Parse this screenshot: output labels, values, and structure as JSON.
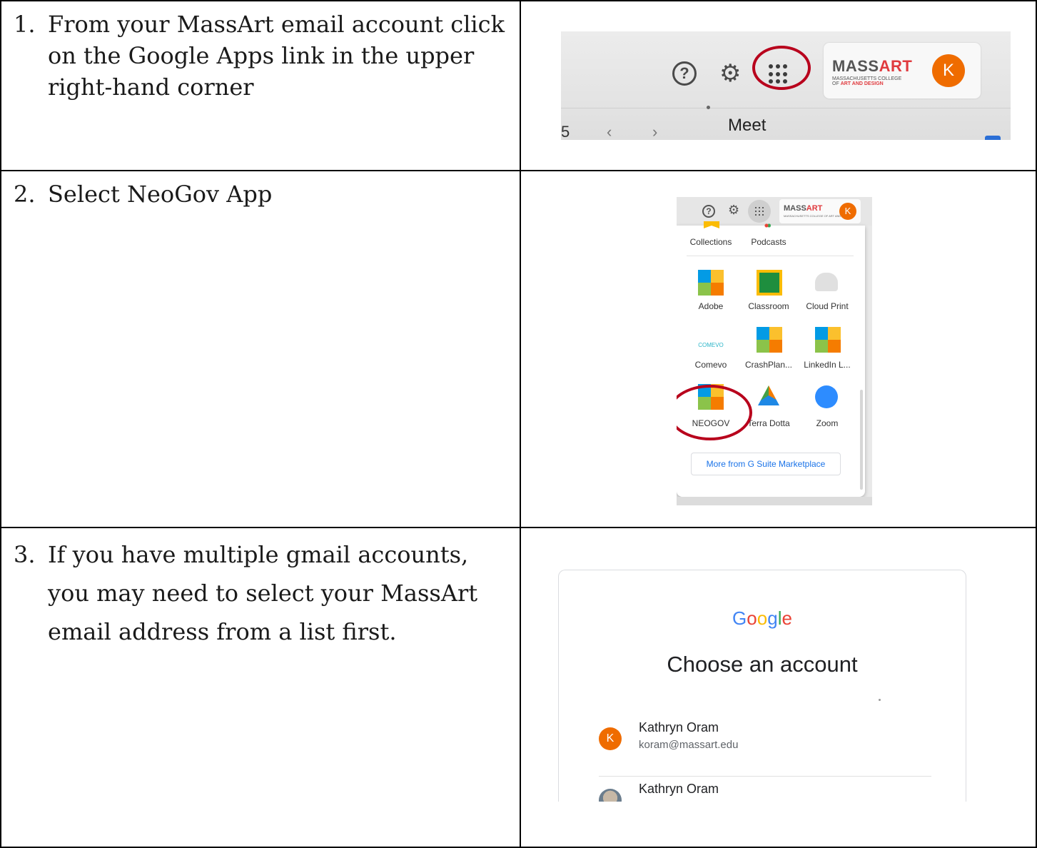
{
  "steps": [
    {
      "number": "1.",
      "text": "From your MassArt email account click on the Google Apps link in the upper right-hand corner"
    },
    {
      "number": "2.",
      "text": "Select NeoGov App"
    },
    {
      "number": "3.",
      "text": "If you have multiple gmail accounts, you may need to select your MassArt email address from a list first."
    }
  ],
  "shot1": {
    "logo_main_gray": "MASS",
    "logo_main_red": "ART",
    "logo_sub_line1": "MASSACHUSETTS COLLEGE",
    "logo_sub_line2_prefix": "OF",
    "logo_sub_line2_red": "ART AND DESIGN",
    "avatar_initial": "K",
    "bottom_left": "5",
    "prev": "‹",
    "next": "›",
    "meet_label": "Meet",
    "help_glyph": "?",
    "gear_glyph": "⚙",
    "highlight_color": "#b8001c"
  },
  "shot2": {
    "help_glyph": "?",
    "gear_glyph": "⚙",
    "logo_gray": "MASS",
    "logo_red": "ART",
    "logo_sub": "MASSACHUSETTS COLLEGE OF ART AND DESIGN",
    "avatar_initial": "K",
    "apps": [
      {
        "label": "Collections",
        "icon": "collections-icon"
      },
      {
        "label": "Podcasts",
        "icon": "podcasts-icon"
      },
      {
        "label": "Adobe",
        "icon": "tile-icon"
      },
      {
        "label": "Classroom",
        "icon": "classroom-icon"
      },
      {
        "label": "Cloud Print",
        "icon": "cloud-print-icon"
      },
      {
        "label": "Comevo",
        "icon": "comevo-icon"
      },
      {
        "label": "CrashPlan...",
        "icon": "tile-icon"
      },
      {
        "label": "LinkedIn L...",
        "icon": "tile-icon"
      },
      {
        "label": "NEOGOV",
        "icon": "tile-icon"
      },
      {
        "label": "Terra Dotta",
        "icon": "terra-dotta-icon"
      },
      {
        "label": "Zoom",
        "icon": "zoom-icon"
      }
    ],
    "comevo_text": "COMEVO",
    "more_button": "More from G Suite Marketplace"
  },
  "shot3": {
    "google_letters": [
      "G",
      "o",
      "o",
      "g",
      "l",
      "e"
    ],
    "heading": "Choose an account",
    "accounts": [
      {
        "initial": "K",
        "name": "Kathryn Oram",
        "email": "koram@massart.edu"
      },
      {
        "name": "Kathryn Oram"
      }
    ]
  }
}
